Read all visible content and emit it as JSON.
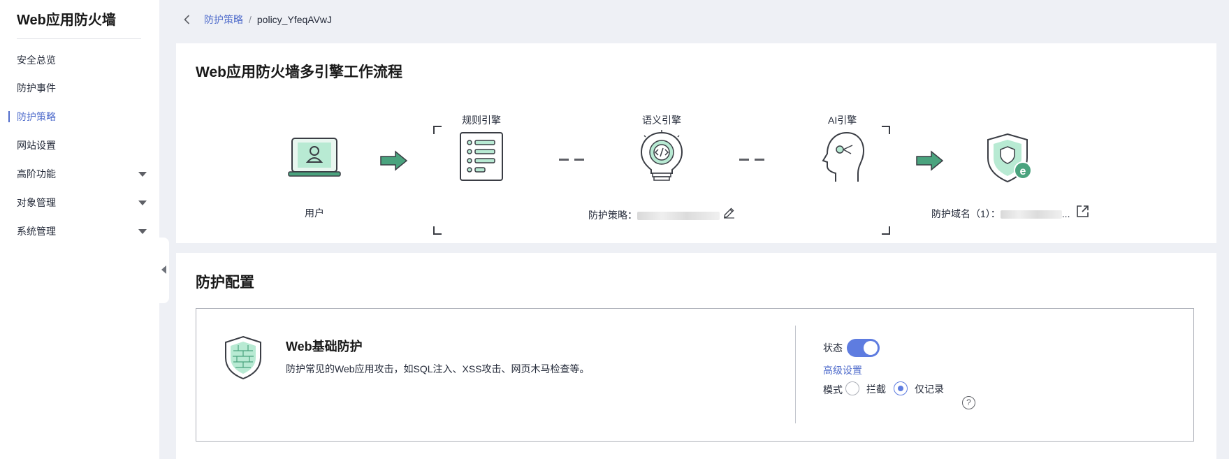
{
  "sidebar": {
    "title": "Web应用防火墙",
    "items": [
      {
        "label": "安全总览"
      },
      {
        "label": "防护事件"
      },
      {
        "label": "防护策略"
      },
      {
        "label": "网站设置"
      },
      {
        "label": "高阶功能"
      },
      {
        "label": "对象管理"
      },
      {
        "label": "系统管理"
      }
    ]
  },
  "breadcrumb": {
    "parent": "防护策略",
    "separator": "/",
    "current": "policy_YfeqAVwJ"
  },
  "workflow": {
    "title": "Web应用防火墙多引擎工作流程",
    "user_label": "用户",
    "rule_engine": "规则引擎",
    "semantic_engine": "语义引擎",
    "ai_engine": "AI引擎",
    "policy_label": "防护策略：",
    "domain_label": "防护域名（1）：",
    "domain_ellipsis": "..."
  },
  "config": {
    "title": "防护配置",
    "module_title": "Web基础防护",
    "module_desc": "防护常见的Web应用攻击，如SQL注入、XSS攻击、网页木马检查等。",
    "status_label": "状态",
    "status_on": true,
    "advanced_link": "高级设置",
    "mode_label": "模式",
    "mode_block": "拦截",
    "mode_log": "仅记录",
    "mode_selected": "仅记录",
    "help_symbol": "?"
  },
  "colors": {
    "accent": "#526ecc",
    "toggle": "#5e7ce0",
    "green": "#4aa37e",
    "mint": "#b8ead3"
  }
}
